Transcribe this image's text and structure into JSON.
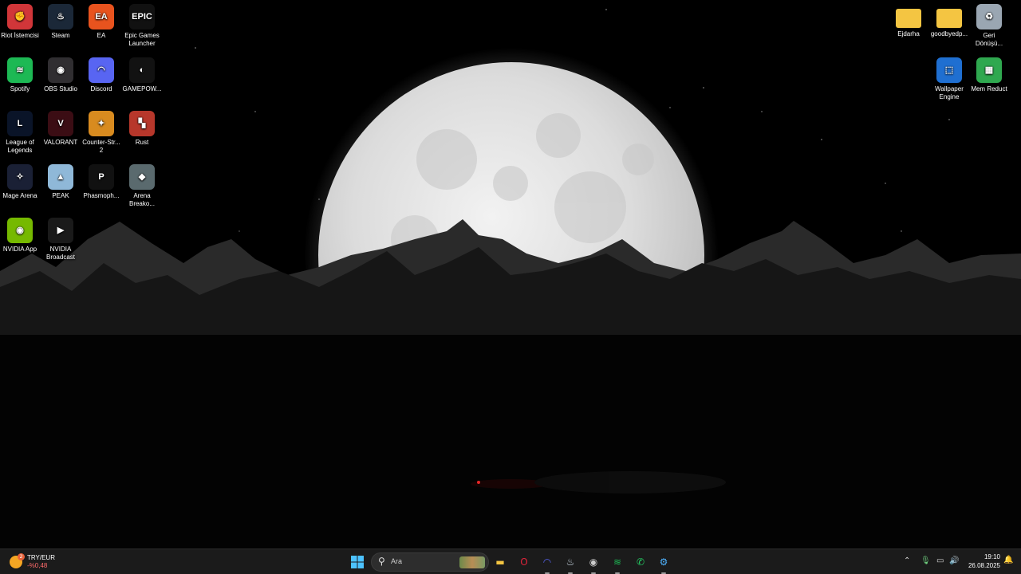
{
  "desktop_left": [
    {
      "id": "riot",
      "label": "Riot İstemcisi",
      "color": "#d13639",
      "glyph": "✊",
      "shortcut": true
    },
    {
      "id": "steam",
      "label": "Steam",
      "color": "#1b2838",
      "glyph": "♨",
      "shortcut": true
    },
    {
      "id": "ea",
      "label": "EA",
      "color": "#e8531e",
      "glyph": "EA",
      "shortcut": true
    },
    {
      "id": "epic",
      "label": "Epic Games Launcher",
      "color": "#111111",
      "glyph": "EPIC",
      "shortcut": true
    },
    {
      "id": "spotify",
      "label": "Spotify",
      "color": "#1db954",
      "glyph": "≋",
      "shortcut": true
    },
    {
      "id": "obs",
      "label": "OBS Studio",
      "color": "#302e31",
      "glyph": "◉",
      "shortcut": false
    },
    {
      "id": "discord",
      "label": "Discord",
      "color": "#5865f2",
      "glyph": "◠",
      "shortcut": true
    },
    {
      "id": "gamepow",
      "label": "GAMEPOW...",
      "color": "#121212",
      "glyph": "◐",
      "shortcut": true
    },
    {
      "id": "lol",
      "label": "League of Legends",
      "color": "#0a1428",
      "glyph": "L",
      "shortcut": true
    },
    {
      "id": "valorant",
      "label": "VALORANT",
      "color": "#3b0d14",
      "glyph": "V",
      "shortcut": true
    },
    {
      "id": "cs2",
      "label": "Counter-Str... 2",
      "color": "#d88b1f",
      "glyph": "✦",
      "shortcut": true
    },
    {
      "id": "rust",
      "label": "Rust",
      "color": "#b7372b",
      "glyph": "▚",
      "shortcut": false
    },
    {
      "id": "mage",
      "label": "Mage Arena",
      "color": "#1a2035",
      "glyph": "✧",
      "shortcut": true
    },
    {
      "id": "peak",
      "label": "PEAK",
      "color": "#8fb8d8",
      "glyph": "▲",
      "shortcut": true
    },
    {
      "id": "phasmo",
      "label": "Phasmoph...",
      "color": "#111111",
      "glyph": "P",
      "shortcut": true
    },
    {
      "id": "arena",
      "label": "Arena Breako...",
      "color": "#5a6a6e",
      "glyph": "◆",
      "shortcut": true
    },
    {
      "id": "nvidia-app",
      "label": "NVIDIA App",
      "color": "#76b900",
      "glyph": "◉",
      "shortcut": true
    },
    {
      "id": "nvidia-broadcast",
      "label": "NVIDIA Broadcast",
      "color": "#1a1a1a",
      "glyph": "▶",
      "shortcut": true
    }
  ],
  "desktop_right": [
    {
      "id": "ejdarha",
      "label": "Ejdarha",
      "color": "#f4c542",
      "glyph": "",
      "shortcut": false
    },
    {
      "id": "goodbye",
      "label": "goodbyedp...",
      "color": "#f4c542",
      "glyph": "",
      "shortcut": false
    },
    {
      "id": "recycle",
      "label": "Geri Dönüşü...",
      "color": "#9aa6b2",
      "glyph": "♻",
      "shortcut": false
    },
    {
      "id": "wallpaper",
      "label": "Wallpaper Engine",
      "color": "#1f6fd1",
      "glyph": "⬚",
      "shortcut": true
    },
    {
      "id": "memreduct",
      "label": "Mem Reduct",
      "color": "#2fa84f",
      "glyph": "▦",
      "shortcut": true
    }
  ],
  "taskbar": {
    "weather": {
      "badge": "2",
      "pair": "TRY/EUR",
      "change": "-%0,48"
    },
    "search_placeholder": "Ara",
    "apps": [
      {
        "id": "start",
        "name": "start-button",
        "glyph": "⊞",
        "color": "#4cc2ff",
        "running": false
      },
      {
        "id": "explorer",
        "name": "file-explorer-taskbar",
        "glyph": "▬",
        "color": "#f4c542",
        "running": false
      },
      {
        "id": "opera",
        "name": "opera-gx-taskbar",
        "glyph": "O",
        "color": "#e0243b",
        "running": false
      },
      {
        "id": "discord",
        "name": "discord-taskbar",
        "glyph": "◠",
        "color": "#5865f2",
        "running": true
      },
      {
        "id": "steam",
        "name": "steam-taskbar",
        "glyph": "♨",
        "color": "#c7d5e0",
        "running": true
      },
      {
        "id": "obs",
        "name": "obs-taskbar",
        "glyph": "◉",
        "color": "#cccccc",
        "running": true
      },
      {
        "id": "spotify",
        "name": "spotify-taskbar",
        "glyph": "≋",
        "color": "#1db954",
        "running": true
      },
      {
        "id": "whatsapp",
        "name": "whatsapp-taskbar",
        "glyph": "✆",
        "color": "#25d366",
        "running": false
      },
      {
        "id": "wallpaper",
        "name": "wallpaper-engine-taskbar",
        "glyph": "⚙",
        "color": "#4fb3ff",
        "running": true
      }
    ],
    "time": "19:10",
    "date": "26.08.2025"
  }
}
